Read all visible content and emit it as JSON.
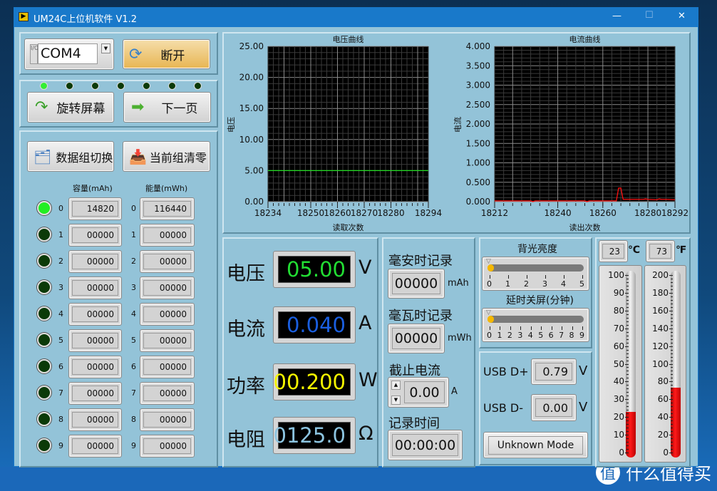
{
  "window": {
    "title": "UM24C上位机软件 V1.2",
    "controls": {
      "minimize": "—",
      "maximize": "☐",
      "close": "✕"
    }
  },
  "connection": {
    "port_label": "I/O",
    "port_value": "COM4",
    "disconnect_label": "断开"
  },
  "page_leds": [
    true,
    false,
    false,
    false,
    false,
    false,
    false
  ],
  "nav": {
    "rotate_label": "旋转屏幕",
    "next_label": "下一页"
  },
  "groups": {
    "switch_label": "数据组切换",
    "clear_label": "当前组清零",
    "capacity_header": "容量(mAh)",
    "energy_header": "能量(mWh)",
    "rows": [
      {
        "index": "0",
        "active": true,
        "capacity": "14820",
        "energy": "116440"
      },
      {
        "index": "1",
        "active": false,
        "capacity": "00000",
        "energy": "00000"
      },
      {
        "index": "2",
        "active": false,
        "capacity": "00000",
        "energy": "00000"
      },
      {
        "index": "3",
        "active": false,
        "capacity": "00000",
        "energy": "00000"
      },
      {
        "index": "4",
        "active": false,
        "capacity": "00000",
        "energy": "00000"
      },
      {
        "index": "5",
        "active": false,
        "capacity": "00000",
        "energy": "00000"
      },
      {
        "index": "6",
        "active": false,
        "capacity": "00000",
        "energy": "00000"
      },
      {
        "index": "7",
        "active": false,
        "capacity": "00000",
        "energy": "00000"
      },
      {
        "index": "8",
        "active": false,
        "capacity": "00000",
        "energy": "00000"
      },
      {
        "index": "9",
        "active": false,
        "capacity": "00000",
        "energy": "00000"
      }
    ]
  },
  "chart_data": [
    {
      "type": "line",
      "title": "电压曲线",
      "xlabel": "读取次数",
      "ylabel": "电压",
      "xlim": [
        18234,
        18294
      ],
      "ylim": [
        0,
        25
      ],
      "xticks": [
        18234,
        18250,
        18260,
        18270,
        18280,
        18294
      ],
      "yticks": [
        "0.00",
        "5.00",
        "10.00",
        "15.00",
        "20.00",
        "25.00"
      ],
      "grid": true,
      "color": "#22dd22",
      "x": [
        18234,
        18294
      ],
      "y": [
        5.0,
        5.0
      ]
    },
    {
      "type": "line",
      "title": "电流曲线",
      "xlabel": "读出次数",
      "ylabel": "电流",
      "xlim": [
        18212,
        18292
      ],
      "ylim": [
        0,
        4
      ],
      "xticks": [
        18212,
        18240,
        18260,
        18280,
        18292
      ],
      "yticks": [
        "0.000",
        "0.500",
        "1.000",
        "1.500",
        "2.000",
        "2.500",
        "3.000",
        "3.500",
        "4.000"
      ],
      "grid": true,
      "color": "#ff1010",
      "x": [
        18212,
        18228,
        18229,
        18230,
        18252,
        18253,
        18254,
        18266,
        18267,
        18268,
        18269,
        18270,
        18278,
        18279,
        18280,
        18284,
        18285,
        18286,
        18288,
        18292
      ],
      "y": [
        0.02,
        0.02,
        0.0,
        0.02,
        0.02,
        0.0,
        0.02,
        0.02,
        0.35,
        0.35,
        0.06,
        0.06,
        0.06,
        0.07,
        0.06,
        0.05,
        0.07,
        0.06,
        0.06,
        0.05
      ]
    }
  ],
  "readings": [
    {
      "label": "电压",
      "value": "05.00",
      "unit": "V",
      "color": "#22dd33"
    },
    {
      "label": "电流",
      "value": "0.040",
      "unit": "A",
      "color": "#1a5fe0"
    },
    {
      "label": "功率",
      "value": "00.200",
      "unit": "W",
      "color": "#f5f500"
    },
    {
      "label": "电阻",
      "value": "0125.0",
      "unit": "Ω",
      "color": "#8cc4e0"
    }
  ],
  "records": {
    "mah_label": "毫安时记录",
    "mah_value": "00000",
    "mah_unit": "mAh",
    "mwh_label": "毫瓦时记录",
    "mwh_value": "00000",
    "mwh_unit": "mWh",
    "cutoff_label": "截止电流",
    "cutoff_value": "0.00",
    "cutoff_unit": "A",
    "time_label": "记录时间",
    "time_value": "00:00:00"
  },
  "sliders": [
    {
      "label": "背光亮度",
      "value": 0,
      "ticks": [
        "0",
        "1",
        "2",
        "3",
        "4",
        "5"
      ]
    },
    {
      "label": "延时关屏(分钟)",
      "value": 0,
      "ticks": [
        "0",
        "1",
        "2",
        "3",
        "4",
        "5",
        "6",
        "7",
        "8",
        "9"
      ]
    }
  ],
  "usb": {
    "dplus_label": "USB D+",
    "dplus_value": "0.79",
    "dminus_label": "USB D-",
    "dminus_value": "0.00",
    "unit": "V",
    "mode_label": "Unknown Mode"
  },
  "temperature": {
    "celsius": "23",
    "celsius_unit": "℃",
    "fahrenheit": "73",
    "fahrenheit_unit": "℉",
    "c_scale": [
      "0",
      "10",
      "20",
      "30",
      "40",
      "50",
      "60",
      "70",
      "80",
      "90",
      "100"
    ],
    "f_scale": [
      "0",
      "20",
      "40",
      "60",
      "80",
      "100",
      "120",
      "140",
      "160",
      "180",
      "200"
    ],
    "c_value": 23,
    "f_value": 73,
    "c_max": 100,
    "f_max": 200
  },
  "watermark": "什么值得买"
}
